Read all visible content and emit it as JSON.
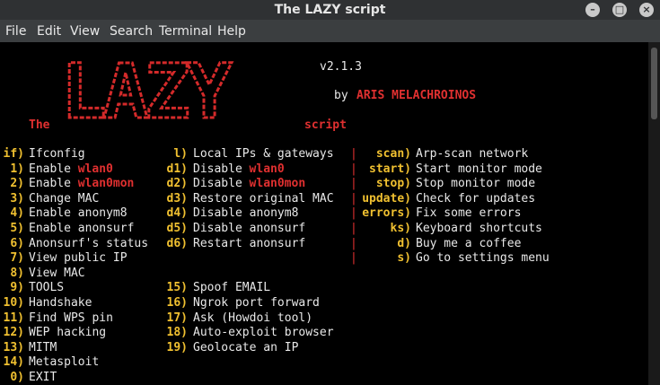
{
  "window": {
    "title": "The LAZY script"
  },
  "menu": [
    "File",
    "Edit",
    "View",
    "Search",
    "Terminal",
    "Help"
  ],
  "header": {
    "logo_text": "LAZY",
    "version": "v2.1.3",
    "by": "by",
    "author": "ARIS MELACHROINOS",
    "the": "The",
    "script": "script"
  },
  "col1": [
    {
      "key": "if)",
      "label": "Ifconfig",
      "extra": ""
    },
    {
      "key": "1)",
      "label": "Enable",
      "extra": "wlan0"
    },
    {
      "key": "2)",
      "label": "Enable",
      "extra": "wlan0mon"
    },
    {
      "key": "3)",
      "label": "Change MAC",
      "extra": ""
    },
    {
      "key": "4)",
      "label": "Enable anonym8",
      "extra": ""
    },
    {
      "key": "5)",
      "label": "Enable anonsurf",
      "extra": ""
    },
    {
      "key": "6)",
      "label": "Anonsurf's status",
      "extra": ""
    },
    {
      "key": "7)",
      "label": "View public IP",
      "extra": ""
    },
    {
      "key": "8)",
      "label": "View MAC",
      "extra": ""
    },
    {
      "key": "9)",
      "label": "TOOLS",
      "extra": ""
    },
    {
      "key": "10)",
      "label": "Handshake",
      "extra": ""
    },
    {
      "key": "11)",
      "label": "Find WPS pin",
      "extra": ""
    },
    {
      "key": "12)",
      "label": "WEP hacking",
      "extra": ""
    },
    {
      "key": "13)",
      "label": "MITM",
      "extra": ""
    },
    {
      "key": "14)",
      "label": "Metasploit",
      "extra": ""
    },
    {
      "key": "0)",
      "label": "EXIT",
      "extra": ""
    }
  ],
  "col2": [
    {
      "key": "l)",
      "label": "Local IPs & gateways",
      "extra": ""
    },
    {
      "key": "d1)",
      "label": "Disable",
      "extra": "wlan0"
    },
    {
      "key": "d2)",
      "label": "Disable",
      "extra": "wlan0mon"
    },
    {
      "key": "d3)",
      "label": "Restore original MAC",
      "extra": ""
    },
    {
      "key": "d4)",
      "label": "Disable anonym8",
      "extra": ""
    },
    {
      "key": "d5)",
      "label": "Disable anonsurf",
      "extra": ""
    },
    {
      "key": "d6)",
      "label": "Restart anonsurf",
      "extra": ""
    },
    {
      "key": "15)",
      "label": "Spoof EMAIL",
      "extra": ""
    },
    {
      "key": "16)",
      "label": "Ngrok port forward",
      "extra": ""
    },
    {
      "key": "17)",
      "label": "Ask (Howdoi tool)",
      "extra": ""
    },
    {
      "key": "18)",
      "label": "Auto-exploit browser",
      "extra": ""
    },
    {
      "key": "19)",
      "label": "Geolocate an IP",
      "extra": ""
    }
  ],
  "col3": [
    {
      "key": "scan)",
      "label": "Arp-scan network"
    },
    {
      "key": "start)",
      "label": "Start monitor mode"
    },
    {
      "key": "stop)",
      "label": "Stop monitor mode"
    },
    {
      "key": "update)",
      "label": "Check for updates"
    },
    {
      "key": "errors)",
      "label": "Fix some errors"
    },
    {
      "key": "ks)",
      "label": "Keyboard shortcuts"
    },
    {
      "key": "d)",
      "label": "Buy me a coffee"
    },
    {
      "key": "s)",
      "label": "Go to settings menu"
    }
  ],
  "separator": "|",
  "colors": {
    "key": "#f0c030",
    "text": "#e8e8e8",
    "accent": "#e03030",
    "background": "#000000"
  }
}
